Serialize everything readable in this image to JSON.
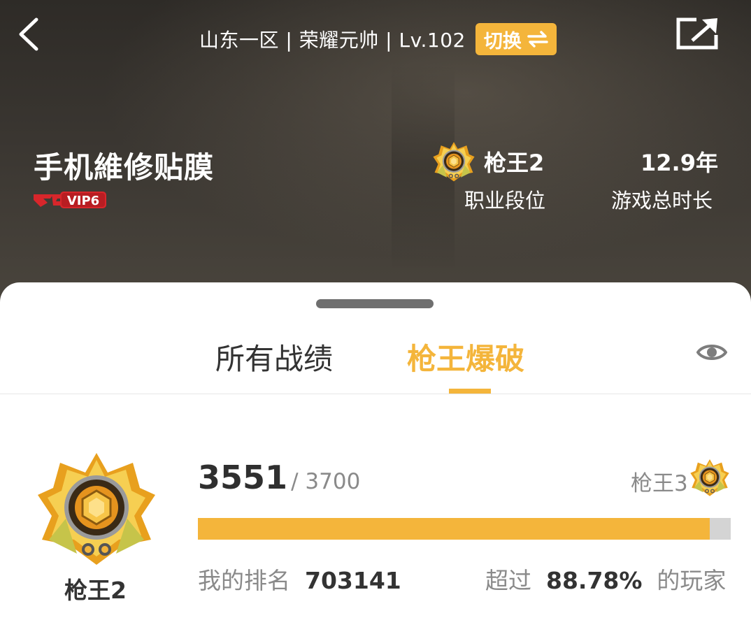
{
  "header": {
    "server": "山东一区",
    "rank_title": "荣耀元帅",
    "level": "Lv.102",
    "switch_label": "切换"
  },
  "profile": {
    "name": "手机維修贴膜",
    "vip_label": "VIP6",
    "career_rank": "枪王2",
    "career_rank_label": "职业段位",
    "play_time": "12.9年",
    "play_time_label": "游戏总时长"
  },
  "tabs": [
    {
      "label": "所有战绩",
      "active": false
    },
    {
      "label": "枪王爆破",
      "active": true
    }
  ],
  "rank_card": {
    "rank_name": "枪王2",
    "score": "3551",
    "score_max": "/ 3700",
    "next_rank": "枪王3",
    "progress": 0.96,
    "my_rank_label": "我的排名",
    "my_rank": "703141",
    "exceed_label": "超过",
    "exceed_percent": "88.78%",
    "players_label": "的玩家"
  },
  "colors": {
    "accent": "#f4b53b",
    "vip_red": "#d8262b",
    "track": "#d4d4d4"
  },
  "icons": [
    "back-arrow-icon",
    "swap-arrows-icon",
    "share-icon",
    "eye-icon",
    "rank-emblem-icon"
  ]
}
